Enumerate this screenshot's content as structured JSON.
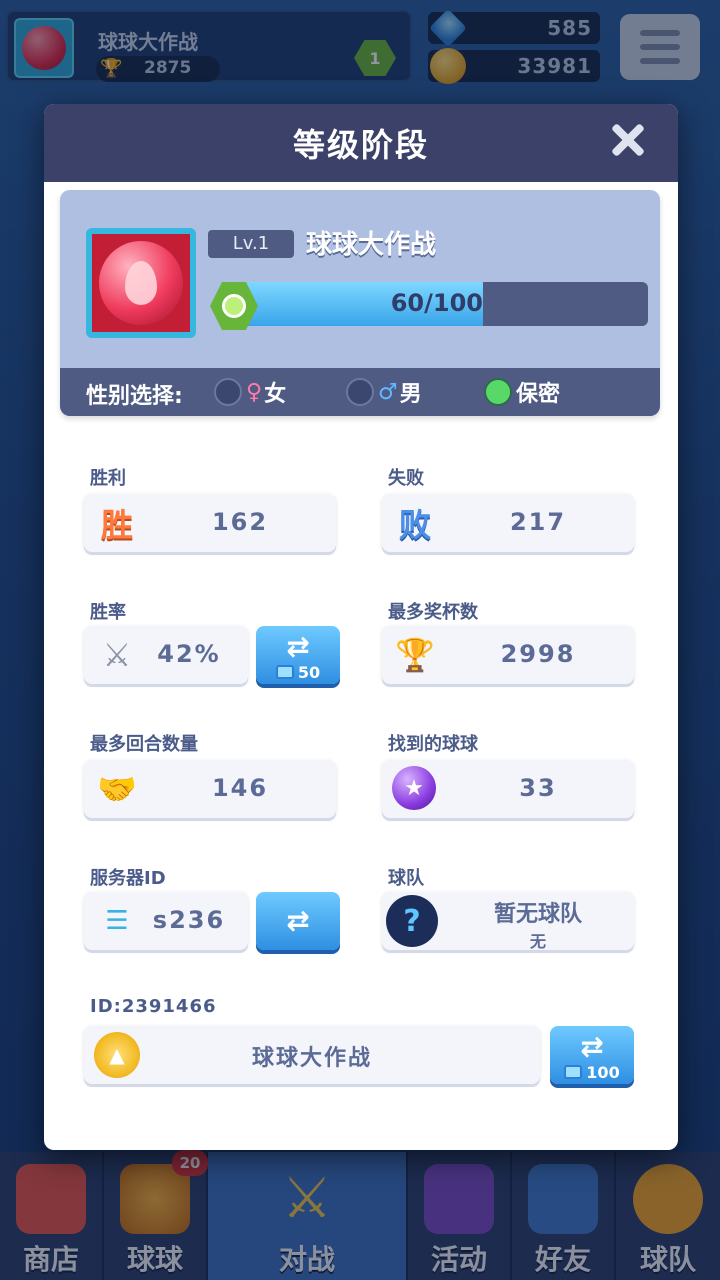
{
  "topbar": {
    "player_name": "球球大作战",
    "trophies": "2875",
    "level": "1",
    "gems": "585",
    "coins": "33981"
  },
  "modal": {
    "title": "等级阶段",
    "profile": {
      "level_tag": "Lv.1",
      "name": "球球大作战",
      "xp_text": "60/100",
      "xp_fraction": 0.6,
      "gender_label": "性别选择:",
      "gender_options": [
        {
          "symbol": "♀",
          "label": "女",
          "selected": false
        },
        {
          "symbol": "♂",
          "label": "男",
          "selected": false
        },
        {
          "symbol": "",
          "label": "保密",
          "selected": true
        }
      ]
    },
    "stats": {
      "wins_label": "胜利",
      "wins_icon": "胜",
      "wins_value": "162",
      "losses_label": "失败",
      "losses_icon": "败",
      "losses_value": "217",
      "winrate_label": "胜率",
      "winrate_value": "42%",
      "winrate_swap_cost": "50",
      "max_trophies_label": "最多奖杯数",
      "max_trophies_value": "2998",
      "max_rounds_label": "最多回合数量",
      "max_rounds_value": "146",
      "balls_found_label": "找到的球球",
      "balls_found_value": "33",
      "server_label": "服务器ID",
      "server_value": "s236",
      "team_label": "球队",
      "team_name": "暂无球队",
      "team_sub": "无",
      "id_label": "ID:2391466",
      "title_value": "球球大作战",
      "title_swap_cost": "100"
    }
  },
  "nav": {
    "items": [
      {
        "label": "商店",
        "icon": "shop-icon"
      },
      {
        "label": "球球",
        "icon": "balls-icon"
      },
      {
        "label": "对战",
        "icon": "battle-icon"
      },
      {
        "label": "活动",
        "icon": "party-icon"
      },
      {
        "label": "好友",
        "icon": "friends-icon"
      },
      {
        "label": "球队",
        "icon": "whistle-icon"
      }
    ],
    "balls_badge": "20"
  }
}
